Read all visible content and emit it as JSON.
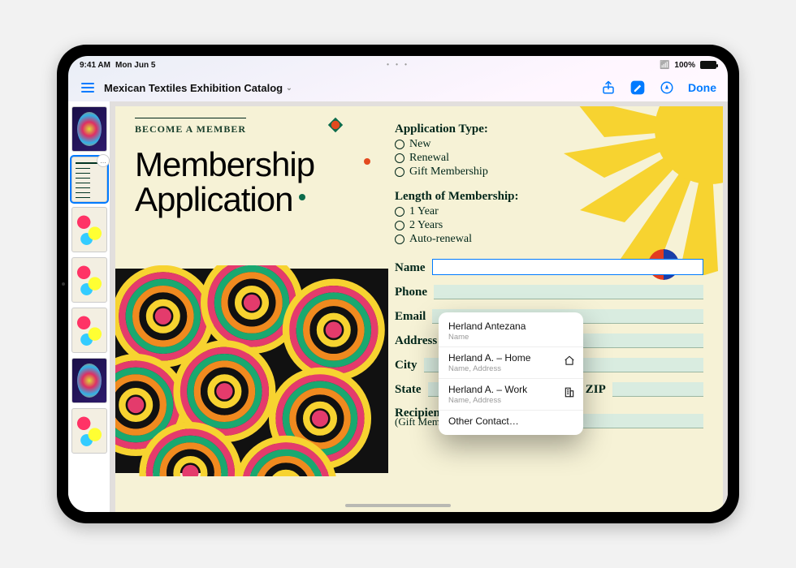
{
  "status": {
    "time": "9:41 AM",
    "date": "Mon Jun 5",
    "battery_pct": "100%"
  },
  "toolbar": {
    "title": "Mexican Textiles Exhibition Catalog",
    "done_label": "Done"
  },
  "doc": {
    "kicker": "BECOME A MEMBER",
    "headline_1": "Membership",
    "headline_2": "Application",
    "app_type": {
      "title": "Application Type:",
      "opts": [
        "New",
        "Renewal",
        "Gift Membership"
      ]
    },
    "length": {
      "title": "Length of Membership:",
      "opts": [
        "1 Year",
        "2 Years",
        "Auto-renewal"
      ]
    },
    "labels": {
      "name": "Name",
      "phone": "Phone",
      "email": "Email",
      "address": "Address",
      "city": "City",
      "state": "State",
      "zip": "ZIP",
      "recipient_1": "Recipient's Name",
      "recipient_2": "(Gift Membership)"
    }
  },
  "autofill": {
    "items": [
      {
        "title": "Herland Antezana",
        "sub": "Name",
        "icon": ""
      },
      {
        "title": "Herland A. – Home",
        "sub": "Name, Address",
        "icon": "home"
      },
      {
        "title": "Herland A. – Work",
        "sub": "Name, Address",
        "icon": "work"
      }
    ],
    "other_label": "Other Contact…"
  }
}
